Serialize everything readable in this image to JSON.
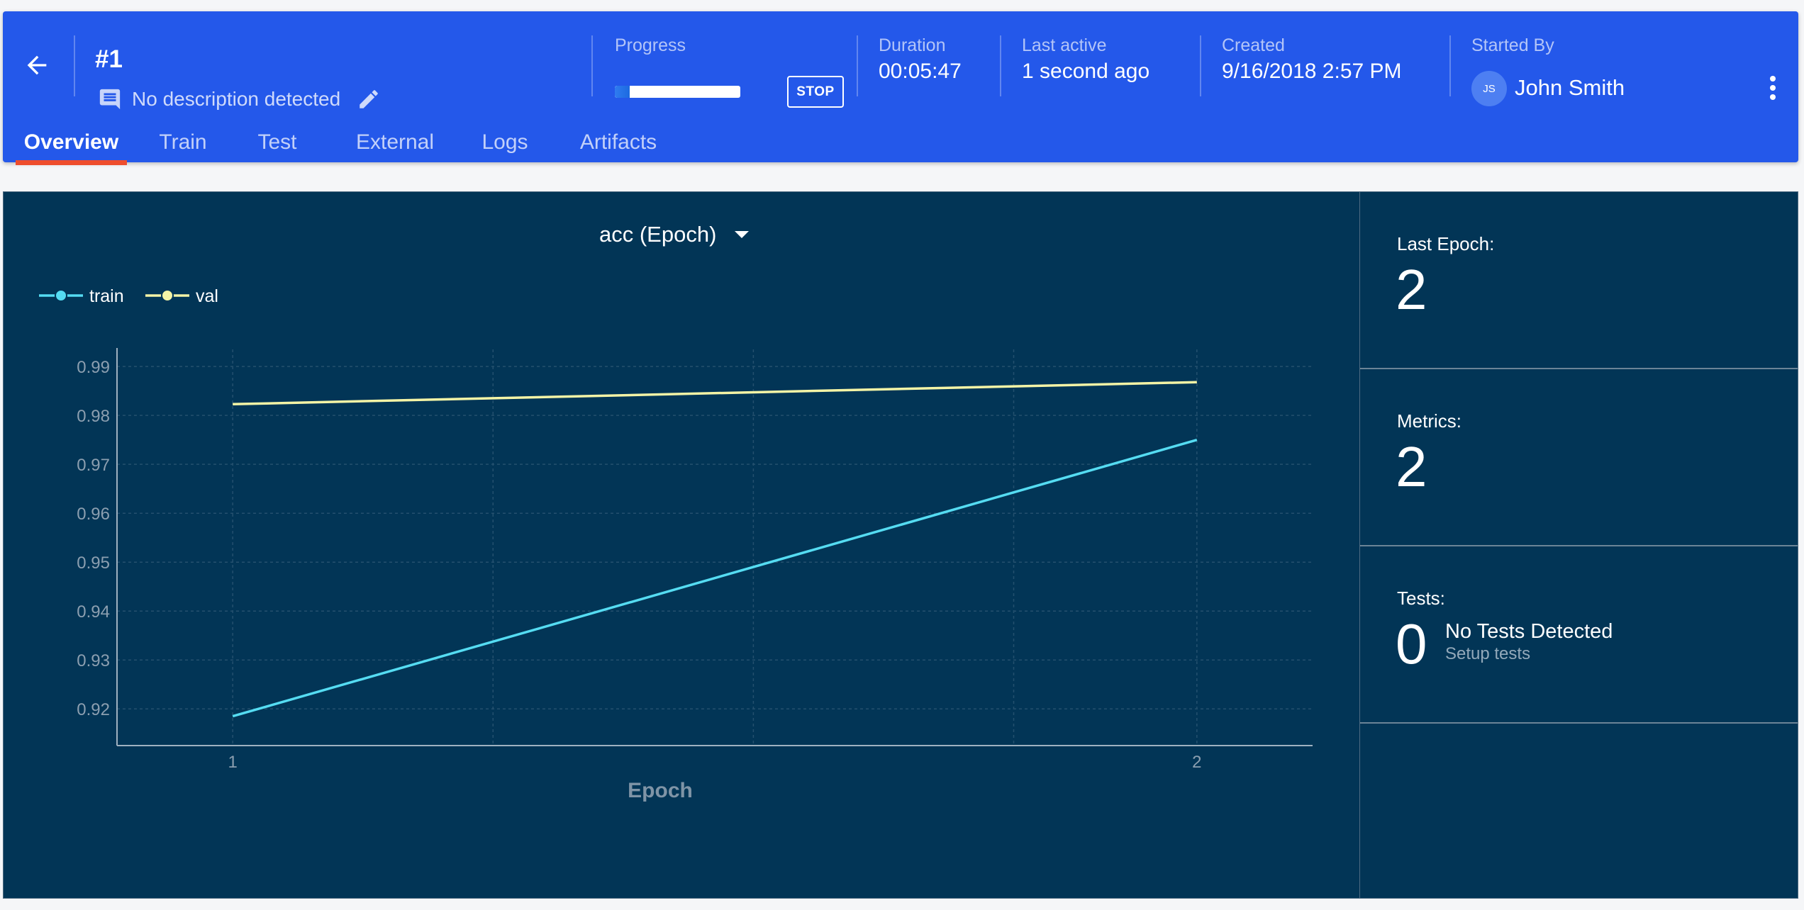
{
  "header": {
    "run_id": "#1",
    "description": "No description detected",
    "progress_label": "Progress",
    "progress_fraction": 0.12,
    "stop_label": "STOP",
    "duration_label": "Duration",
    "duration_value": "00:05:47",
    "last_active_label": "Last active",
    "last_active_value": "1 second ago",
    "created_label": "Created",
    "created_value": "9/16/2018 2:57 PM",
    "started_by_label": "Started By",
    "started_by_initials": "JS",
    "started_by_name": "John Smith"
  },
  "tabs": [
    {
      "label": "Overview",
      "active": true
    },
    {
      "label": "Train",
      "active": false
    },
    {
      "label": "Test",
      "active": false
    },
    {
      "label": "External",
      "active": false
    },
    {
      "label": "Logs",
      "active": false
    },
    {
      "label": "Artifacts",
      "active": false
    }
  ],
  "colors": {
    "header_bg": "#2458ea",
    "panel_bg": "#023556",
    "tab_indicator": "#ee4d2d",
    "train_line": "#55dcf2",
    "val_line": "#f4f4a6"
  },
  "chart_data": {
    "type": "line",
    "selector_label": "acc (Epoch)",
    "xlabel": "Epoch",
    "ylabel": "",
    "x": [
      1,
      2
    ],
    "xlim": [
      0.88,
      2.12
    ],
    "ylim": [
      0.9125,
      0.9935
    ],
    "y_ticks": [
      0.92,
      0.93,
      0.94,
      0.95,
      0.96,
      0.97,
      0.98,
      0.99
    ],
    "x_ticks": [
      1,
      2
    ],
    "grid": true,
    "legend_position": "top-left",
    "series": [
      {
        "name": "train",
        "values": [
          0.9185,
          0.975
        ],
        "color": "#55dcf2"
      },
      {
        "name": "val",
        "values": [
          0.9823,
          0.9868
        ],
        "color": "#f4f4a6"
      }
    ]
  },
  "stats": {
    "last_epoch_label": "Last Epoch:",
    "last_epoch_value": "2",
    "metrics_label": "Metrics:",
    "metrics_value": "2",
    "tests_label": "Tests:",
    "tests_value": "0",
    "no_tests_text": "No Tests Detected",
    "setup_tests_text": "Setup tests"
  },
  "icons": [
    "arrow-back-icon",
    "comment-icon",
    "pencil-icon",
    "more-vert-icon",
    "dropdown-caret-icon"
  ]
}
